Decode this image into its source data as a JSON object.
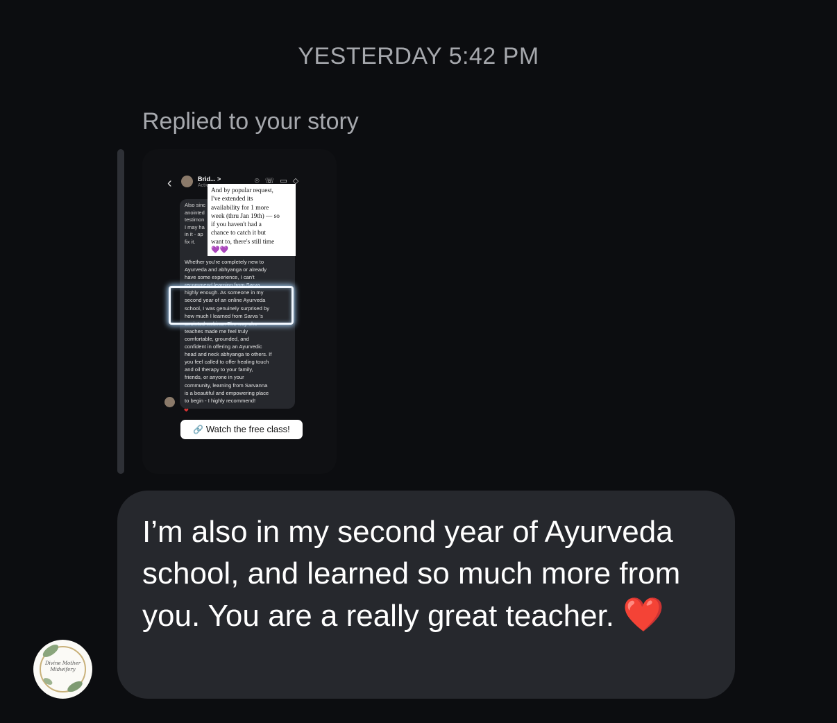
{
  "header": {
    "timestamp": "YESTERDAY 5:42 PM"
  },
  "story_reply": {
    "label": "Replied to your story",
    "story": {
      "chat_name": "Brid...",
      "chat_name_chevron": ">",
      "chat_status": "Activ",
      "back_icon": "chevron-left-icon",
      "header_icons": [
        "location-pin-icon",
        "phone-icon",
        "video-icon",
        "tag-icon"
      ],
      "partial_lines": [
        "Also sinc",
        "anointed",
        "testimon",
        "I may ha",
        "in it - ap",
        "fix it."
      ],
      "testimonial_lines": [
        "Whether you're completely new to",
        "Ayurveda and abhyanga or already",
        "have some experience, I can't",
        "recommend learning from Sarva",
        "highly enough. As someone in my",
        "second year of an online Ayurveda",
        "school, I was genuinely surprised by",
        "how much I learned from Sarva      's",
        "anointed webinar. The way she",
        "teaches made me feel truly",
        "comfortable, grounded, and",
        "confident in offering an Ayurvedic",
        "head and neck abhyanga to others. If",
        "you feel called to offer healing touch",
        "and oil therapy to your family,",
        "friends, or anyone in your",
        "community, learning from Sarvanna",
        "is a beautiful and empowering place",
        "to begin - I highly recommend!"
      ],
      "note_lines": [
        "And by popular request,",
        "I've extended its",
        "availability for 1 more",
        "week (thru Jan 19th) — so",
        "if you haven't had a",
        "chance to catch it but",
        "want to, there's still time"
      ],
      "note_hearts": "💜💜",
      "reaction": "❤",
      "link_icon": "link-icon",
      "link_label": "Watch the free class!"
    }
  },
  "message": {
    "text": "I’m also in my second year of Ayurveda school, and learned so much more from you. You are a really great teacher.",
    "emoji": "❤️"
  },
  "sender": {
    "avatar_text": "Divine Mother Midwifery",
    "avatar_icon": "leaf-logo-icon"
  },
  "colors": {
    "background": "#0c0d10",
    "bubble": "#26282d",
    "muted_text": "#a6a8ad",
    "heart": "#e0262e"
  }
}
